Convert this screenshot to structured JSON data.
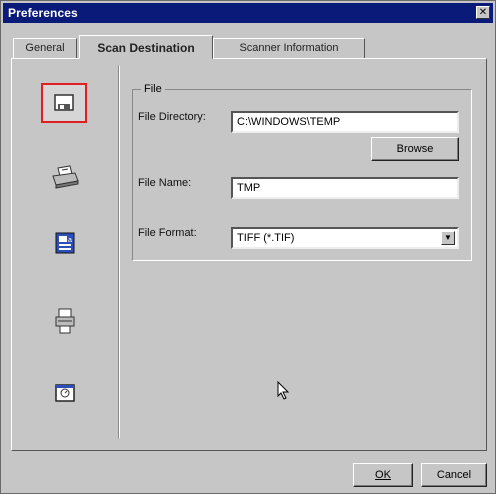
{
  "window": {
    "title": "Preferences"
  },
  "tabs": [
    {
      "label": "General"
    },
    {
      "label": "Scan Destination"
    },
    {
      "label": "Scanner Information"
    }
  ],
  "file_group": {
    "title": "File",
    "directory_label": "File Directory:",
    "directory_value": "C:\\WINDOWS\\TEMP",
    "browse_label": "Browse",
    "name_label": "File Name:",
    "name_value": "TMP",
    "format_label": "File Format:",
    "format_value": "TIFF (*.TIF)"
  },
  "footer": {
    "ok_label": "OK",
    "cancel_label": "Cancel"
  },
  "icons": [
    "save-to-disk-icon",
    "printer-icon",
    "ocr-document-icon",
    "fax-icon",
    "email-icon"
  ],
  "colors": {
    "titlebar": "#0a1a78",
    "selection_border": "#e02020"
  }
}
